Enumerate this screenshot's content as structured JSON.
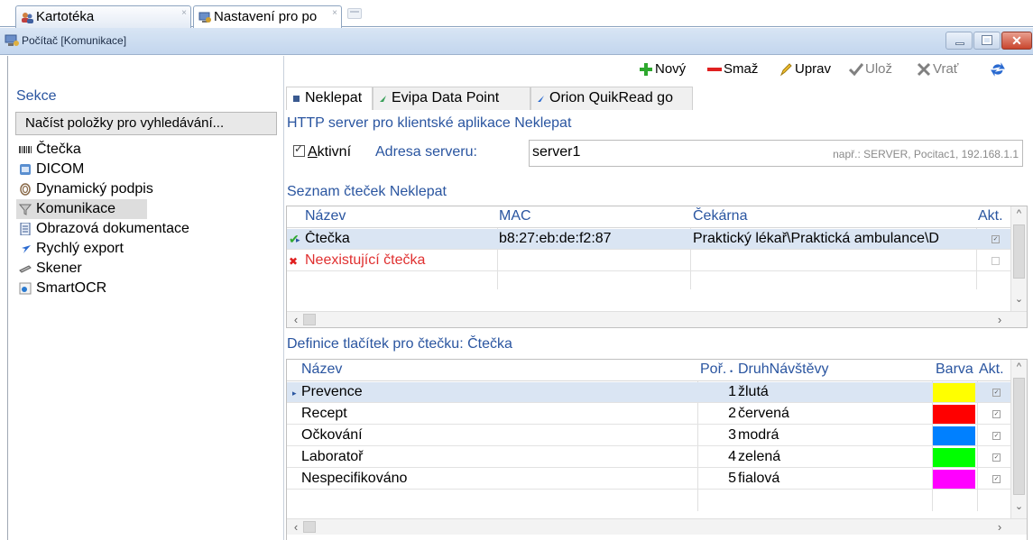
{
  "doc_tabs": [
    {
      "label": "Kartotéka"
    },
    {
      "label": "Nastavení pro po"
    }
  ],
  "window": {
    "title": "Počítač [Komunikace]"
  },
  "sidebar": {
    "section_label": "Sekce",
    "load_button": "Načíst položky pro vyhledávání...",
    "items": [
      {
        "label": "Čtečka",
        "icon": "barcode-icon"
      },
      {
        "label": "DICOM",
        "icon": "dicom-icon"
      },
      {
        "label": "Dynamický podpis",
        "icon": "fingerprint-icon"
      },
      {
        "label": "Komunikace",
        "icon": "funnel-icon",
        "selected": true
      },
      {
        "label": "Obrazová dokumentace",
        "icon": "document-icon"
      },
      {
        "label": "Rychlý export",
        "icon": "arrow-icon"
      },
      {
        "label": "Skener",
        "icon": "scanner-icon"
      },
      {
        "label": "SmartOCR",
        "icon": "ocr-icon"
      }
    ]
  },
  "toolbar": {
    "new_label": "Nový",
    "delete_label": "Smaž",
    "edit_label": "Uprav",
    "save_label": "Ulož",
    "revert_label": "Vrať"
  },
  "inner_tabs": [
    {
      "label": "Neklepat",
      "active": true
    },
    {
      "label": "Evipa Data Point"
    },
    {
      "label": "Orion QuikRead go"
    }
  ],
  "server_section": {
    "title": "HTTP server pro klientské aplikace Neklepat",
    "active_label_prefix": "A",
    "active_label_rest": "ktivní",
    "active_checked": true,
    "server_label": "Adresa serveru:",
    "server_value": "server1",
    "server_hint": "např.: SERVER, Pocitac1, 192.168.1.1"
  },
  "readers": {
    "title": "Seznam čteček Neklepat",
    "columns": {
      "name": "Název",
      "mac": "MAC",
      "waiting_room": "Čekárna",
      "active": "Akt."
    },
    "rows": [
      {
        "name": "Čtečka",
        "mac": "b8:27:eb:de:f2:87",
        "waiting_room": "Praktický lékař\\Praktická ambulance\\D",
        "status": "ok",
        "active": true
      },
      {
        "name": "Neexistující čtečka",
        "mac": "",
        "waiting_room": "",
        "status": "error",
        "active": false
      }
    ]
  },
  "buttons_def": {
    "title": "Definice tlačítek pro čtečku: Čtečka",
    "columns": {
      "name": "Název",
      "order": "Poř.",
      "visit_type": "DruhNávštěvy",
      "color": "Barva",
      "active": "Akt."
    },
    "rows": [
      {
        "name": "Prevence",
        "order": "1",
        "visit_type": "žlutá",
        "color": "#ffff00",
        "active": true
      },
      {
        "name": "Recept",
        "order": "2",
        "visit_type": "červená",
        "color": "#ff0000",
        "active": true
      },
      {
        "name": "Očkování",
        "order": "3",
        "visit_type": "modrá",
        "color": "#0080ff",
        "active": true
      },
      {
        "name": "Laboratoř",
        "order": "4",
        "visit_type": "zelená",
        "color": "#00ff00",
        "active": true
      },
      {
        "name": "Nespecifikováno",
        "order": "5",
        "visit_type": "fialová",
        "color": "#ff00ff",
        "active": true
      }
    ]
  }
}
